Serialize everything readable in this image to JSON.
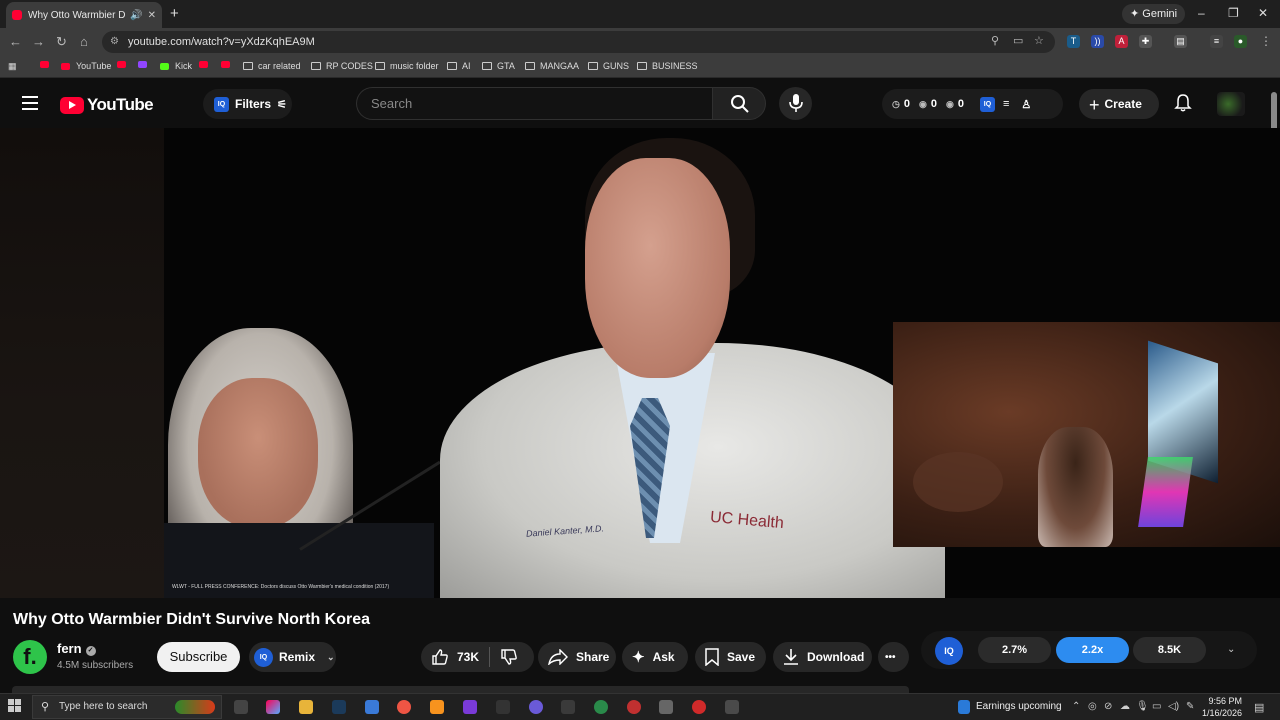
{
  "browser": {
    "tab_title": "Why Otto Warmbier Didn't",
    "new_tab": "+",
    "gemini": "Gemini",
    "url": "youtube.com/watch?v=yXdzKqhEA9M",
    "window_controls": [
      "–",
      "❐",
      "✕"
    ]
  },
  "bookmarks": [
    {
      "label": "",
      "kind": "yt"
    },
    {
      "label": "YouTube",
      "kind": "yt"
    },
    {
      "label": "",
      "kind": "yt"
    },
    {
      "label": "",
      "kind": "twitch"
    },
    {
      "label": "Kick",
      "kind": "kick"
    },
    {
      "label": "",
      "kind": "yt"
    },
    {
      "label": "",
      "kind": "yt"
    },
    {
      "label": "car related",
      "kind": "folder"
    },
    {
      "label": "RP CODES",
      "kind": "folder"
    },
    {
      "label": "music folder",
      "kind": "folder"
    },
    {
      "label": "AI",
      "kind": "folder"
    },
    {
      "label": "GTA",
      "kind": "folder"
    },
    {
      "label": "MANGAA",
      "kind": "folder"
    },
    {
      "label": "GUNS",
      "kind": "folder"
    },
    {
      "label": "BUSINESS",
      "kind": "folder"
    }
  ],
  "header": {
    "logo": "YouTube",
    "filters": "Filters",
    "search_placeholder": "Search",
    "stats": [
      "0",
      "0",
      "0"
    ],
    "create": "Create",
    "iq": "IQ"
  },
  "video": {
    "caption": "WLWT - FULL PRESS CONFERENCE: Doctors discuss Otto Warmbier's medical condition (2017)",
    "nametag": "Daniel Kanter, M.D.",
    "health_logo": "UC Health"
  },
  "meta": {
    "title": "Why Otto Warmbier Didn't Survive North Korea",
    "channel": "fern",
    "channel_initial": "f.",
    "subscribers": "4.5M subscribers",
    "subscribe": "Subscribe",
    "remix": "Remix",
    "likes": "73K",
    "share": "Share",
    "ask": "Ask",
    "save": "Save",
    "download": "Download",
    "more": "•••"
  },
  "iq_bar": {
    "logo": "IQ",
    "values": [
      "2.7%",
      "2.2x",
      "8.5K"
    ],
    "highlight_color": "#2d8cf0"
  },
  "taskbar": {
    "search_placeholder": "Type here to search",
    "news": "Earnings upcoming",
    "time": "9:56 PM",
    "date": "1/16/2026"
  }
}
